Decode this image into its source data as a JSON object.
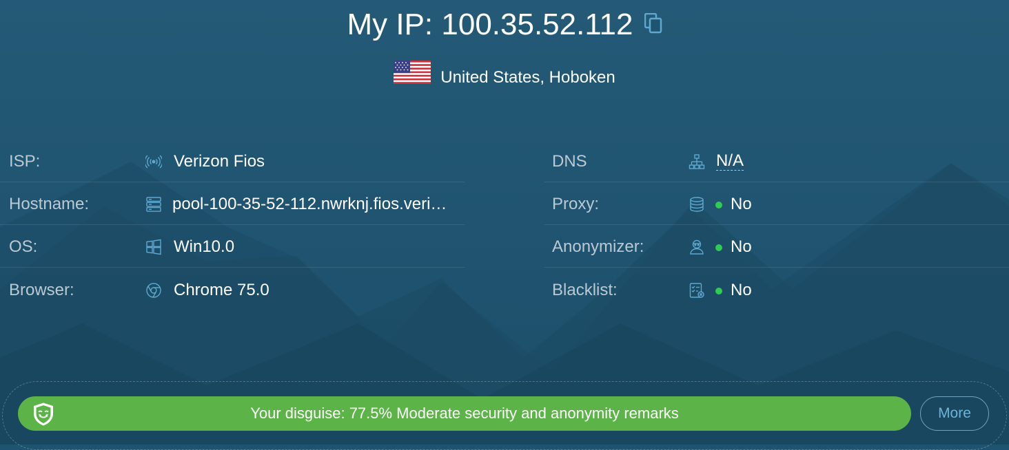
{
  "header": {
    "ip_title": "My IP: 100.35.52.112",
    "location": "United States, Hoboken"
  },
  "left_rows": [
    {
      "label": "ISP:",
      "value": "Verizon Fios",
      "icon": "antenna-signal-icon"
    },
    {
      "label": "Hostname:",
      "value": "pool-100-35-52-112.nwrknj.fios.veri…",
      "icon": "server-icon"
    },
    {
      "label": "OS:",
      "value": "Win10.0",
      "icon": "windows-icon"
    },
    {
      "label": "Browser:",
      "value": "Chrome 75.0",
      "icon": "chrome-icon"
    }
  ],
  "right_rows": [
    {
      "label": "DNS",
      "value": "N/A",
      "icon": "network-tree-icon"
    },
    {
      "label": "Proxy:",
      "value": "No",
      "icon": "database-icon",
      "status": "ok"
    },
    {
      "label": "Anonymizer:",
      "value": "No",
      "icon": "anonymous-user-icon",
      "status": "ok"
    },
    {
      "label": "Blacklist:",
      "value": "No",
      "icon": "checklist-icon",
      "status": "ok"
    }
  ],
  "bottom": {
    "disguise_text": "Your disguise: 77.5% Moderate security and anonymity remarks",
    "more_label": "More"
  },
  "colors": {
    "background": "#1f5470",
    "accent_green": "#5cb448",
    "status_green": "#2ecc52",
    "label_gray": "#b9cad4",
    "icon_blue": "#5fa8cf"
  }
}
